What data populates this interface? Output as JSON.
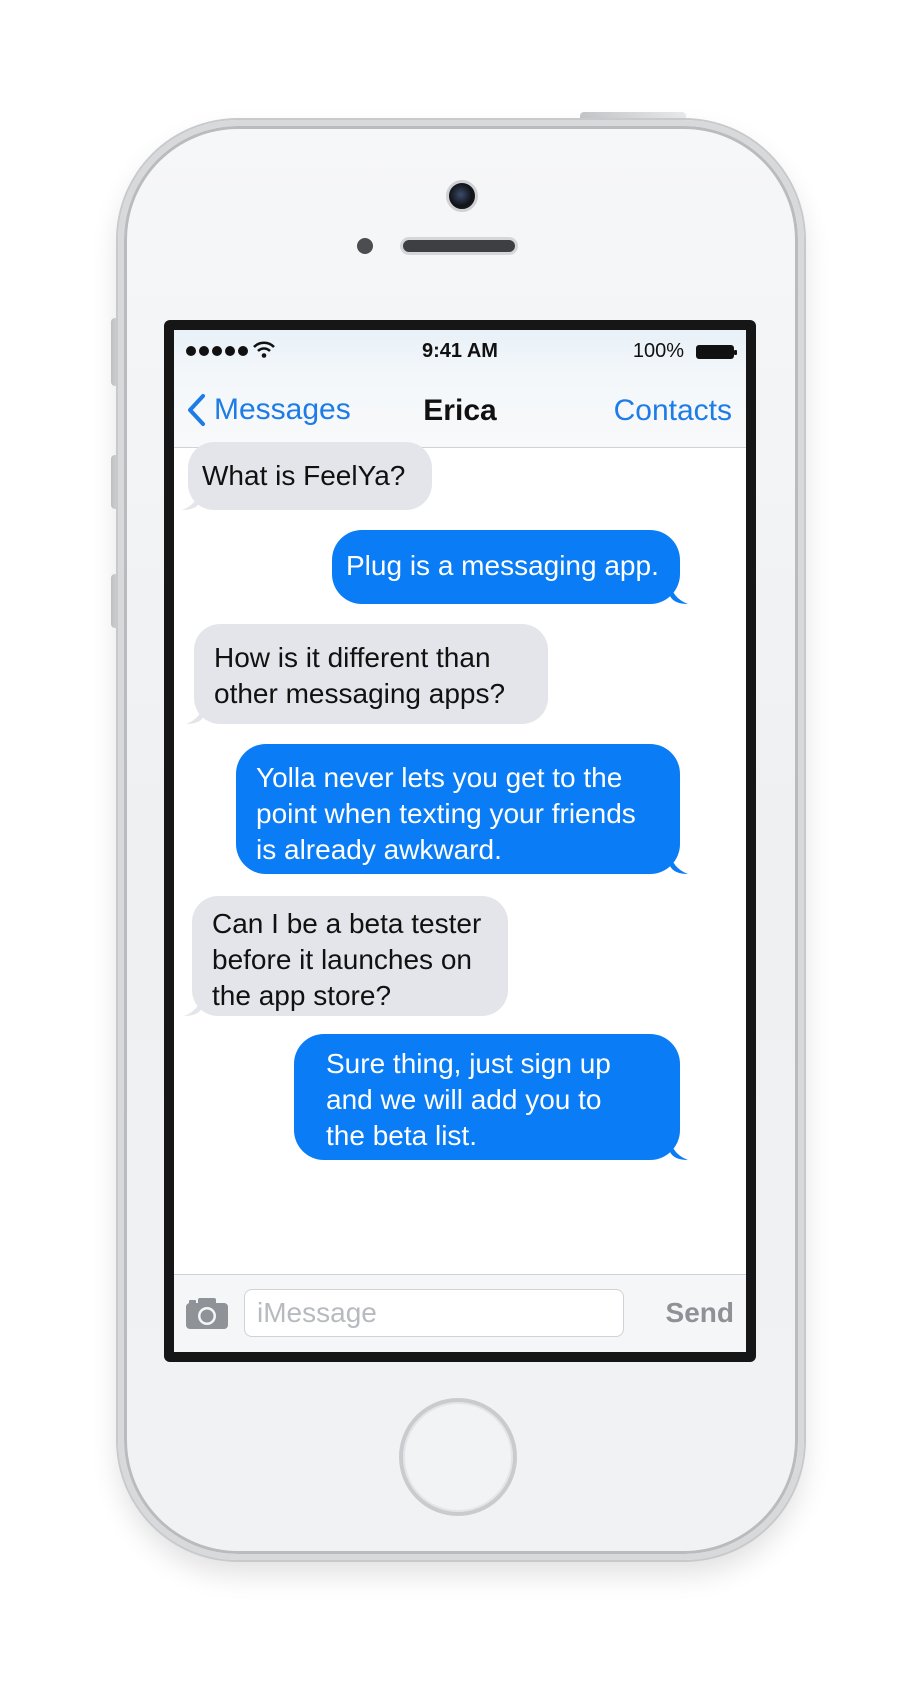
{
  "status_bar": {
    "time": "9:41 AM",
    "battery_percent": "100%",
    "signal_bars": 5,
    "wifi_icon": "wifi-icon",
    "battery_icon": "battery-full-icon"
  },
  "nav": {
    "back_label": "Messages",
    "back_icon": "chevron-left-icon",
    "title": "Erica",
    "right_label": "Contacts"
  },
  "messages": [
    {
      "direction": "incoming",
      "text": "What is FeelYa?"
    },
    {
      "direction": "outgoing",
      "text": "Plug is a messaging app."
    },
    {
      "direction": "incoming",
      "text": "How is it different than other messaging apps?"
    },
    {
      "direction": "outgoing",
      "text": "Yolla never lets you get to the point when texting your friends is already awkward."
    },
    {
      "direction": "incoming",
      "text": "Can I be a beta tester before it launches on the app store?"
    },
    {
      "direction": "outgoing",
      "text": "Sure thing, just sign up and we will add you to the beta list."
    }
  ],
  "compose": {
    "camera_icon": "camera-icon",
    "placeholder": "iMessage",
    "value": "",
    "send_label": "Send"
  },
  "colors": {
    "accent": "#1d7ce6",
    "outgoing_bubble": "#0a7cf5",
    "incoming_bubble": "#e4e5ea"
  }
}
